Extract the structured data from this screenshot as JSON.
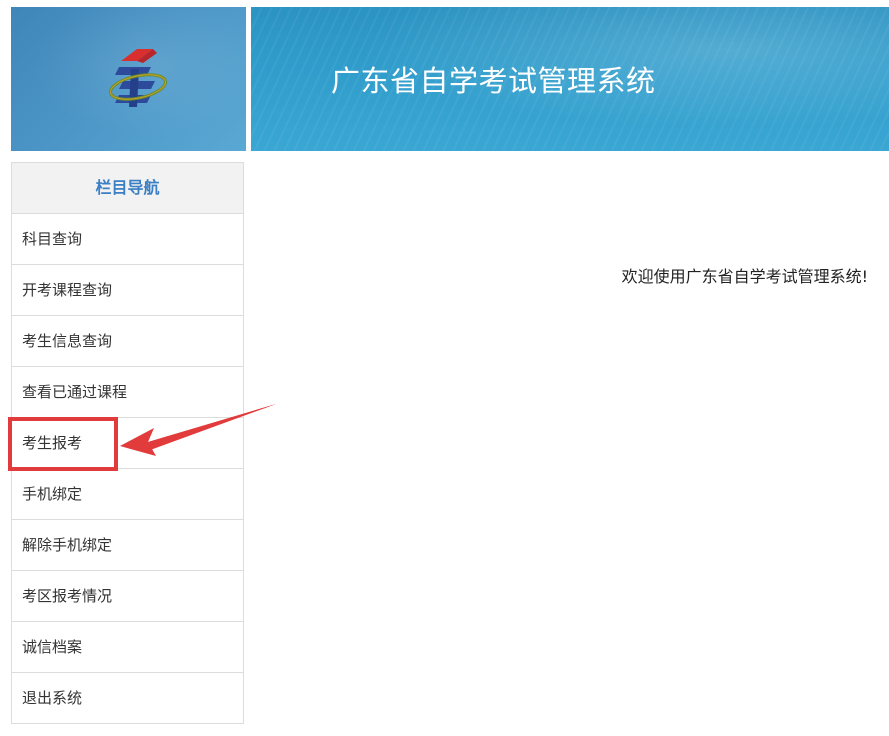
{
  "header": {
    "title": "广东省自学考试管理系统",
    "logo_icon": "exam-authority-logo-icon",
    "logo_color_primary": "#2e4a9a",
    "logo_color_accent": "#d9302f",
    "logo_color_ring": "#6b8c2a"
  },
  "nav": {
    "header": "栏目导航",
    "header_color": "#3b7fc4",
    "items": [
      {
        "label": "科目查询"
      },
      {
        "label": "开考课程查询"
      },
      {
        "label": "考生信息查询"
      },
      {
        "label": "查看已通过课程"
      },
      {
        "label": "考生报考"
      },
      {
        "label": "手机绑定"
      },
      {
        "label": "解除手机绑定"
      },
      {
        "label": "考区报考情况"
      },
      {
        "label": "诚信档案"
      },
      {
        "label": "退出系统"
      }
    ]
  },
  "main": {
    "welcome": "欢迎使用广东省自学考试管理系统!"
  },
  "annotation": {
    "highlight_color": "#e23b3b",
    "target_item": "考生报考"
  }
}
